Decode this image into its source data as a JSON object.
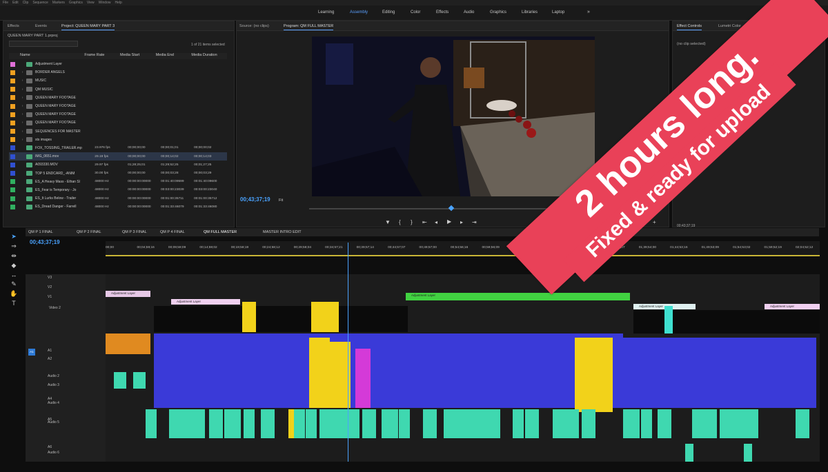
{
  "menu": [
    "File",
    "Edit",
    "Clip",
    "Sequence",
    "Markers",
    "Graphics",
    "View",
    "Window",
    "Help"
  ],
  "workspaces": {
    "tabs": [
      "Learning",
      "Assembly",
      "Editing",
      "Color",
      "Effects",
      "Audio",
      "Graphics",
      "Libraries",
      "Laptop"
    ],
    "active": "Assembly",
    "more": "»"
  },
  "project_panel": {
    "tabs": [
      "Effects",
      "Events",
      "Project: QUEEN MARY PART 3"
    ],
    "project_file": "QUEEN MARY PART 1.prproj",
    "items_selected": "1 of 21 items selected",
    "columns": [
      "Name",
      "Frame Rate",
      "Media Start",
      "Media End",
      "Media Duration"
    ],
    "rows": [
      {
        "color": "#e070d8",
        "name": "Adjustment Layer",
        "rate": "",
        "start": "",
        "end": "",
        "dur": "",
        "folder": false
      },
      {
        "color": "#f0a020",
        "name": "BORDER ANGELS",
        "rate": "",
        "start": "",
        "end": "",
        "dur": "",
        "folder": true
      },
      {
        "color": "#f0a020",
        "name": "MUSIC",
        "rate": "",
        "start": "",
        "end": "",
        "dur": "",
        "folder": true
      },
      {
        "color": "#f0a020",
        "name": "QM MUSIC",
        "rate": "",
        "start": "",
        "end": "",
        "dur": "",
        "folder": true
      },
      {
        "color": "#f0a020",
        "name": "QUEEN MARY FOOTAGE",
        "rate": "",
        "start": "",
        "end": "",
        "dur": "",
        "folder": true
      },
      {
        "color": "#f0a020",
        "name": "QUEEN MARY FOOTAGE",
        "rate": "",
        "start": "",
        "end": "",
        "dur": "",
        "folder": true
      },
      {
        "color": "#f0a020",
        "name": "QUEEN MARY FOOTAGE",
        "rate": "",
        "start": "",
        "end": "",
        "dur": "",
        "folder": true
      },
      {
        "color": "#f0a020",
        "name": "QUEEN MARY FOOTAGE",
        "rate": "",
        "start": "",
        "end": "",
        "dur": "",
        "folder": true
      },
      {
        "color": "#f0a020",
        "name": "SEQUENCES FOR MASTER",
        "rate": "",
        "start": "",
        "end": "",
        "dur": "",
        "folder": true
      },
      {
        "color": "#f0a020",
        "name": "sts images",
        "rate": "",
        "start": "",
        "end": "",
        "dur": "",
        "folder": true
      },
      {
        "color": "#3050d0",
        "name": "FOX_TOSSING_TRAILER.mp",
        "rate": "23.976 fps",
        "start": "00;00;00;00",
        "end": "00;00;01;01",
        "dur": "00;00;00;02",
        "folder": false
      },
      {
        "color": "#3050d0",
        "name": "IMG_0651.mov",
        "rate": "29.19 fps",
        "start": "00;00;00;00",
        "end": "00;00;14;02",
        "dur": "00;00;14;03",
        "folder": false,
        "selected": true
      },
      {
        "color": "#3050d0",
        "name": "A093330.MOV",
        "rate": "29.97 fps",
        "start": "01;28;25;01",
        "end": "01;29;52;25",
        "dur": "00;01;27;25",
        "folder": false
      },
      {
        "color": "#3050d0",
        "name": "TOP 5 ENDCARD_-ANIM",
        "rate": "30.00 fps",
        "start": "00;00;00;00",
        "end": "00;00;03;28",
        "dur": "00;00;03;29",
        "folder": false
      },
      {
        "color": "#30b060",
        "name": "ES_A Heavy Mass - Ethan Sl",
        "rate": "48000 Hz",
        "start": "00:00:00:00000",
        "end": "00:01:40:09599",
        "dur": "00:01:40:09600",
        "folder": false
      },
      {
        "color": "#30b060",
        "name": "ES_Fear is Temporary - Jo",
        "rate": "48000 Hz",
        "start": "00:00:00:00000",
        "end": "00:03:00:23039",
        "dur": "00:03:00:23040",
        "folder": false
      },
      {
        "color": "#30b060",
        "name": "ES_It Lurks Below - Trailer",
        "rate": "48000 Hz",
        "start": "00:00:00:00000",
        "end": "00:01:00:35711",
        "dur": "00:01:00:35712",
        "folder": false
      },
      {
        "color": "#30b060",
        "name": "ES_Dread Danger - Farrell",
        "rate": "48000 Hz",
        "start": "00:00:00:00000",
        "end": "00:01:33:46079",
        "dur": "00:01:33:46080",
        "folder": false
      }
    ]
  },
  "source_monitor": {
    "tab": "Source: (no clips)"
  },
  "program_monitor": {
    "tab": "Program: QM FULL MASTER",
    "timecode": "00;43;37;19",
    "fit": "Fit"
  },
  "effect_controls": {
    "tabs": [
      "Effect Controls",
      "Lumetri Color"
    ],
    "no_clip": "(no clip selected)",
    "timecode": "00;43;37;19"
  },
  "timeline": {
    "tabs": [
      "QM P 1 FINAL",
      "QM P 2 FINAL",
      "QM P 3 FINAL",
      "QM P 4 FINAL",
      "QM FULL MASTER",
      "MASTER INTRO EDIT"
    ],
    "active_tab": "QM FULL MASTER",
    "timecode": "00;43;37;19",
    "ruler_ticks": [
      "00;00",
      "00;04;59;16",
      "00;09;59;09",
      "00;14;59;02",
      "00;19;58;19",
      "00;24;58;12",
      "00;29;58;04",
      "00;34;57;21",
      "00;39;57;14",
      "00;44;57;07",
      "00;49;57;00",
      "00;54;56;16",
      "00;59;56;09",
      "01;04;56;02",
      "01;09;55;19",
      "01;29;54;14",
      "01;34;54;07",
      "01;39;54;00",
      "01;44;53;16",
      "01;49;53;09",
      "01;54;53;02",
      "01;59;52;19",
      "02;04;52;12"
    ],
    "video_tracks": [
      "V3",
      "V2",
      "V1",
      "Video 2"
    ],
    "audio_tracks": [
      "A1",
      "A2",
      "Audio 2",
      "Audio 3",
      "A4",
      "Audio 4",
      "A5",
      "Audio 5",
      "A6",
      "Audio 6"
    ],
    "clip_label": "Adjustment Layer"
  },
  "overlay": {
    "line1": "2 hours long.",
    "line2": "Fixed & ready for upload"
  },
  "colors": {
    "accent": "#5aa0ff",
    "banner": "#e94158",
    "audio_blue": "#3a3ad8",
    "audio_teal": "#3fd8b0",
    "clip_yellow": "#f2d21a",
    "clip_green": "#41d241",
    "clip_pink": "#d43ad8",
    "clip_orange": "#e08a20"
  }
}
